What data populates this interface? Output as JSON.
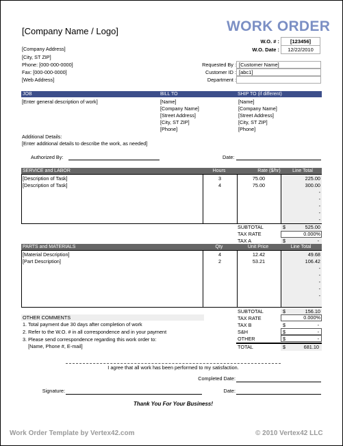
{
  "header": {
    "company_name": "[Company Name / Logo]",
    "address_lines": [
      "[Company Address]",
      "[City, ST  ZIP]",
      "Phone: [000-000-0000]",
      "Fax: [000-000-0000]",
      "[Web Address]"
    ],
    "title": "WORK ORDER",
    "wo_number_label": "W.O. # :",
    "wo_number": "[123456]",
    "wo_date_label": "W.O. Date :",
    "wo_date": "12/22/2010",
    "requested_by_label": "Requested By :",
    "requested_by": "[Customer Name]",
    "customer_id_label": "Customer ID :",
    "customer_id": "[abc1]",
    "department_label": "Department :",
    "department": ""
  },
  "job": {
    "job_header": "JOB",
    "job_description": "[Enter general description of work]",
    "bill_to_header": "BILL TO",
    "bill_to": [
      "[Name]",
      "[Company Name]",
      "[Street Address]",
      "[City, ST  ZIP]",
      "[Phone]"
    ],
    "ship_to_header": "SHIP TO (if different)",
    "ship_to": [
      "[Name]",
      "[Company Name]",
      "[Street Address]",
      "[City, ST  ZIP]",
      "[Phone]"
    ],
    "additional_label": "Additional Details:",
    "additional_text": "[Enter additional details to describe the work, as needed]",
    "authorized_label": "Authorized By:",
    "date_label": "Date:"
  },
  "service": {
    "header": "SERVICE and LABOR",
    "col_hours": "Hours",
    "col_rate": "Rate ($/hr)",
    "col_total": "Line Total",
    "rows": [
      {
        "desc": "[Description of Task]",
        "qty": "3",
        "rate": "75.00",
        "total": "225.00"
      },
      {
        "desc": "[Description of Task]",
        "qty": "4",
        "rate": "75.00",
        "total": "300.00"
      },
      {
        "desc": "",
        "qty": "",
        "rate": "",
        "total": "-"
      },
      {
        "desc": "",
        "qty": "",
        "rate": "",
        "total": "-"
      },
      {
        "desc": "",
        "qty": "",
        "rate": "",
        "total": "-"
      },
      {
        "desc": "",
        "qty": "",
        "rate": "",
        "total": "-"
      },
      {
        "desc": "",
        "qty": "",
        "rate": "",
        "total": "-"
      }
    ],
    "subtotal_label": "SUBTOTAL",
    "subtotal": "525.00",
    "taxrate_label": "TAX RATE",
    "taxrate": "0.000%",
    "tax_label": "TAX A",
    "tax": "-",
    "currency": "$"
  },
  "parts": {
    "header": "PARTS and MATERIALS",
    "col_qty": "Qty",
    "col_price": "Unit Price",
    "col_total": "Line Total",
    "rows": [
      {
        "desc": "[Material Description]",
        "qty": "4",
        "price": "12.42",
        "total": "49.68"
      },
      {
        "desc": "[Part Description]",
        "qty": "2",
        "price": "53.21",
        "total": "106.42"
      },
      {
        "desc": "",
        "qty": "",
        "price": "",
        "total": "-"
      },
      {
        "desc": "",
        "qty": "",
        "price": "",
        "total": "-"
      },
      {
        "desc": "",
        "qty": "",
        "price": "",
        "total": "-"
      },
      {
        "desc": "",
        "qty": "",
        "price": "",
        "total": "-"
      },
      {
        "desc": "",
        "qty": "",
        "price": "",
        "total": "-"
      }
    ],
    "subtotal_label": "SUBTOTAL",
    "subtotal": "156.10",
    "taxrate_label": "TAX RATE",
    "taxrate": "0.000%",
    "taxb_label": "TAX B",
    "taxb": "-",
    "sh_label": "S&H",
    "sh": "-",
    "other_label": "OTHER",
    "other": "-",
    "total_label": "TOTAL",
    "total": "681.10",
    "currency": "$"
  },
  "comments": {
    "header": "OTHER COMMENTS",
    "lines": [
      "1. Total payment due 30 days after completion of work",
      "2. Refer to the W.O. # in all correspondence and in your payment",
      "3. Please send correspondence regarding this work order to:",
      "    [Name, Phone #, E-mail]"
    ]
  },
  "signoff": {
    "agree_text": "I agree that all work has been performed to my satisfaction.",
    "completed_date_label": "Completed Date:",
    "signature_label": "Signature:",
    "date_label": "Date:",
    "thank_you": "Thank You For Your Business!"
  },
  "footer": {
    "left": "Work Order Template by Vertex42.com",
    "right": "© 2010 Vertex42 LLC"
  }
}
